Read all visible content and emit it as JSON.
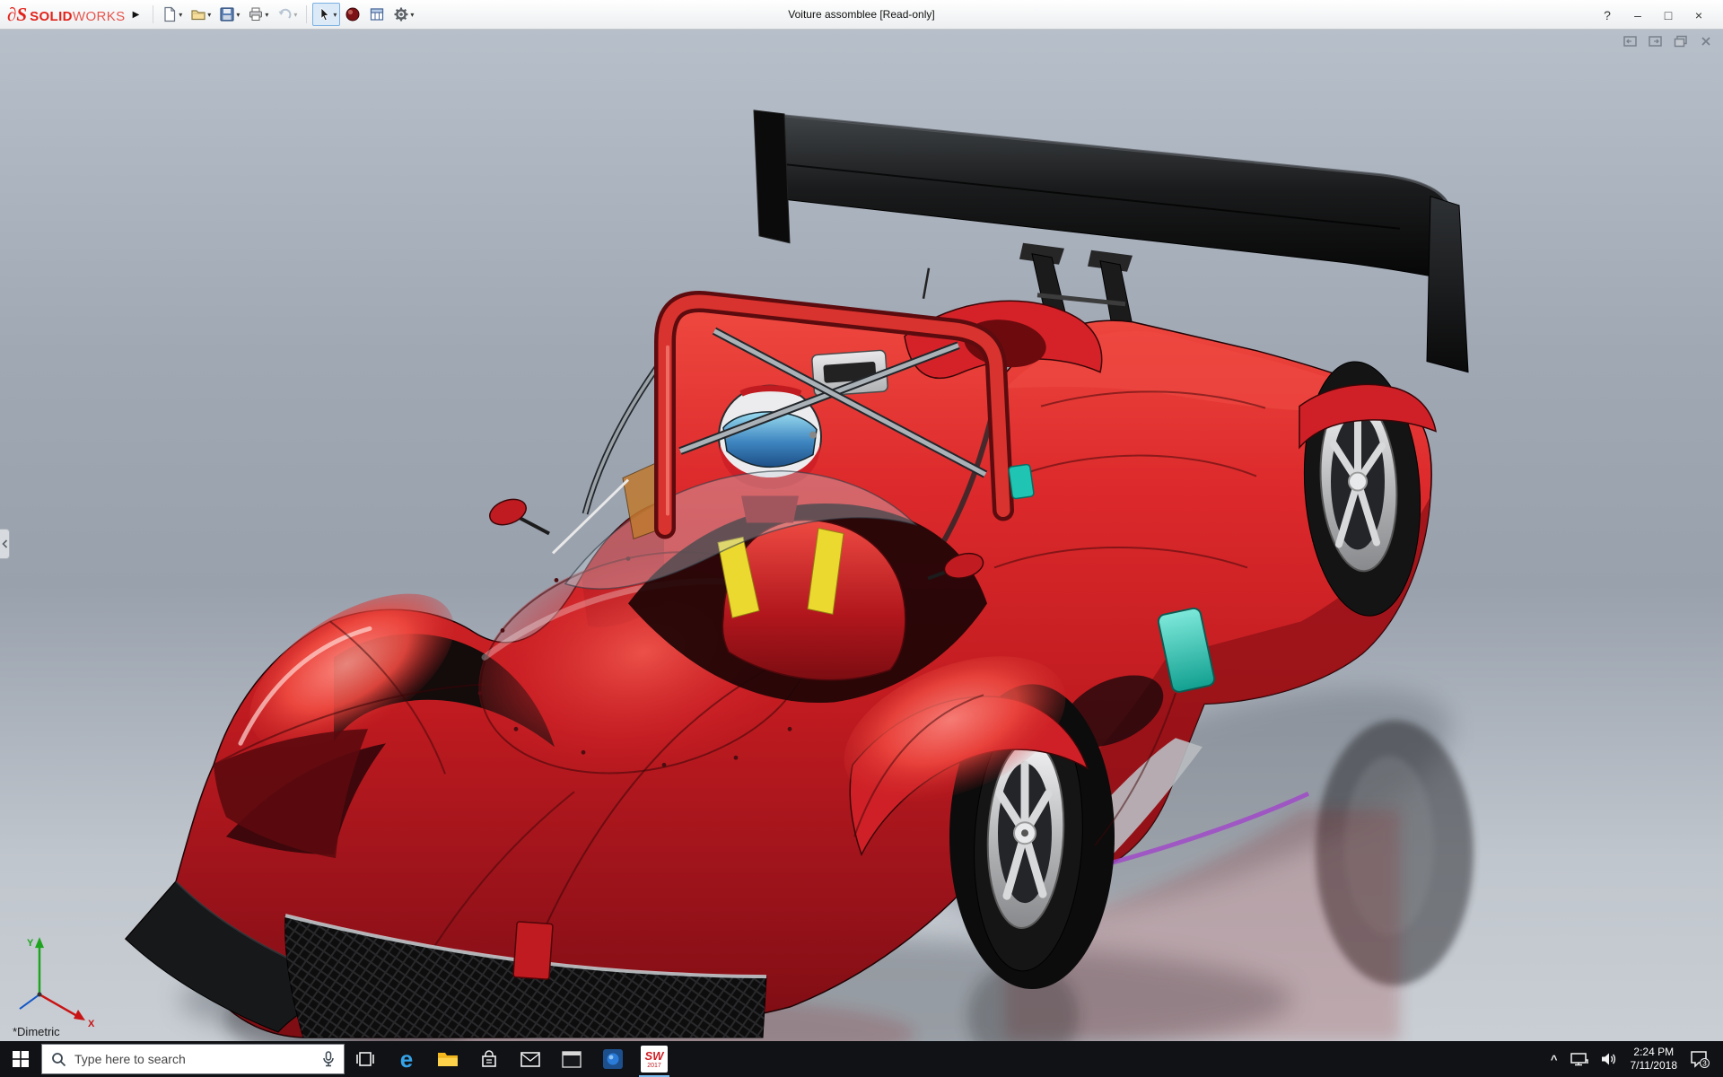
{
  "titlebar": {
    "ds_glyph": "∂S",
    "brand_bold": "SOLID",
    "brand_light": "WORKS",
    "expander_glyph": "▶",
    "title": "Voiture assomblee [Read-only]",
    "help_glyph": "?",
    "minimize_glyph": "–",
    "maximize_glyph": "□",
    "close_glyph": "×"
  },
  "viewport": {
    "view_label": "*Dimetric",
    "axis_x": "X",
    "axis_y": "Y"
  },
  "taskbar": {
    "search_placeholder": "Type here to search",
    "edge_glyph": "e",
    "sw_logo_text": "SW",
    "sw_logo_year": "2017",
    "tray_caret_glyph": "^",
    "clock_time": "2:24 PM",
    "clock_date": "7/11/2018",
    "notification_count": "3"
  },
  "colors": {
    "body_red": "#d01f26",
    "body_dark_red": "#8c1016",
    "wing_black": "#141414",
    "accent_teal": "#1fc4b2",
    "harness_yellow": "#ecd92f",
    "background_top": "#b7bfca",
    "background_bottom": "#c9ced4",
    "taskbar_bg": "#101216"
  }
}
